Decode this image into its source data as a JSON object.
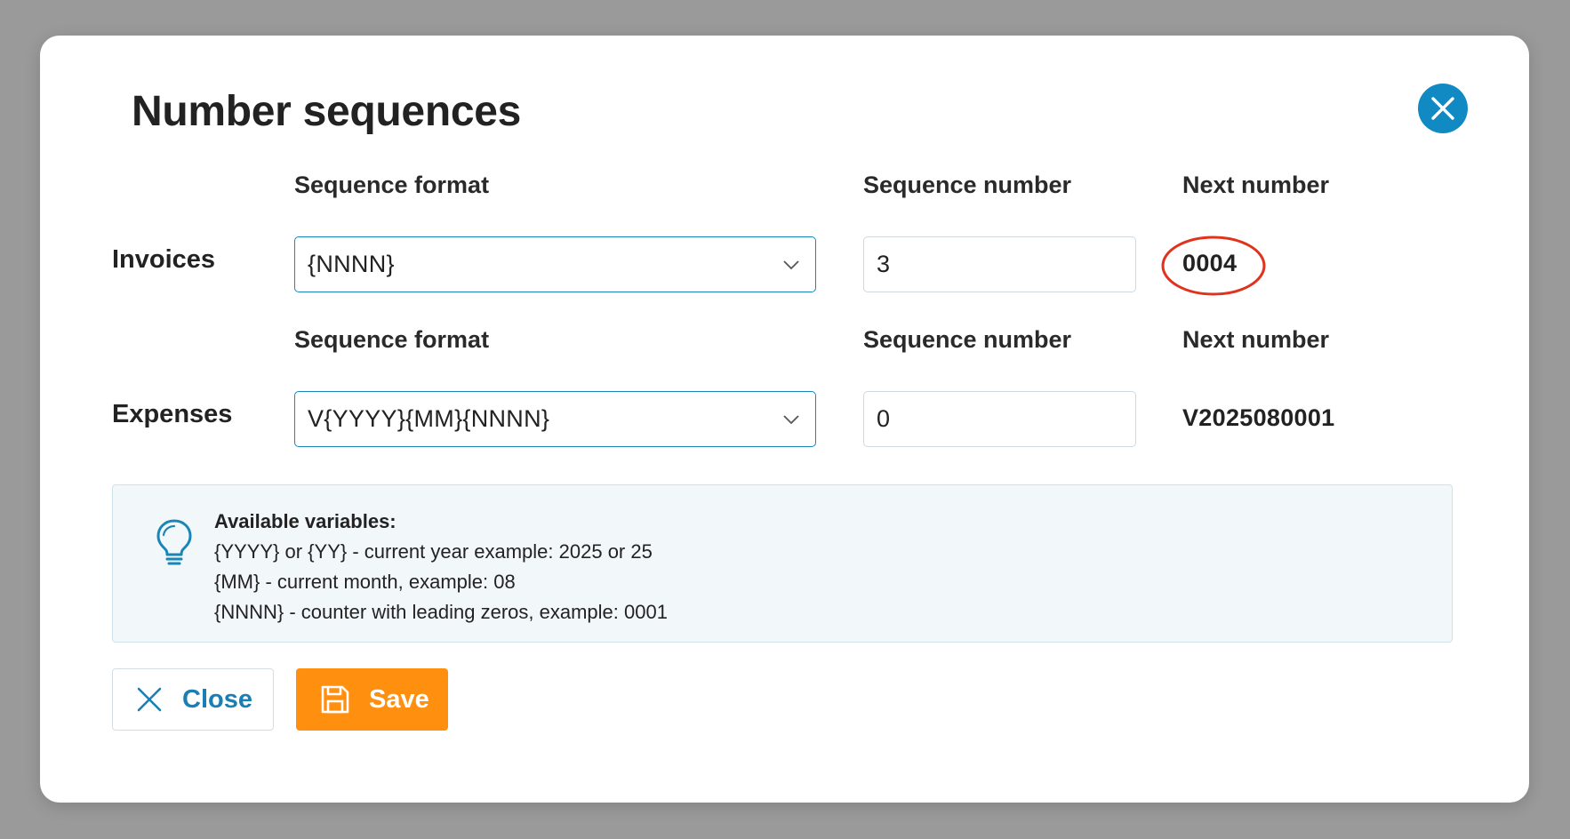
{
  "modal": {
    "title": "Number sequences"
  },
  "rows": [
    {
      "label": "Invoices",
      "format_label": "Sequence format",
      "format_value": "{NNNN}",
      "number_label": "Sequence number",
      "number_value": "3",
      "next_label": "Next number",
      "next_value": "0004"
    },
    {
      "label": "Expenses",
      "format_label": "Sequence format",
      "format_value": "V{YYYY}{MM}{NNNN}",
      "number_label": "Sequence number",
      "number_value": "0",
      "next_label": "Next number",
      "next_value": "V2025080001"
    }
  ],
  "info": {
    "icon": "lightbulb-icon",
    "title": "Available variables:",
    "lines": [
      "{YYYY} or {YY} - current year example: 2025 or 25",
      "{MM} - current month, example: 08",
      "{NNNN} - counter with leading zeros, example: 0001"
    ]
  },
  "buttons": {
    "close_label": "Close",
    "save_label": "Save"
  },
  "colors": {
    "accent_blue": "#1189c3",
    "save_orange": "#ff8f0f",
    "highlight_red": "#e0321c",
    "info_bg": "#f2f7fa"
  }
}
